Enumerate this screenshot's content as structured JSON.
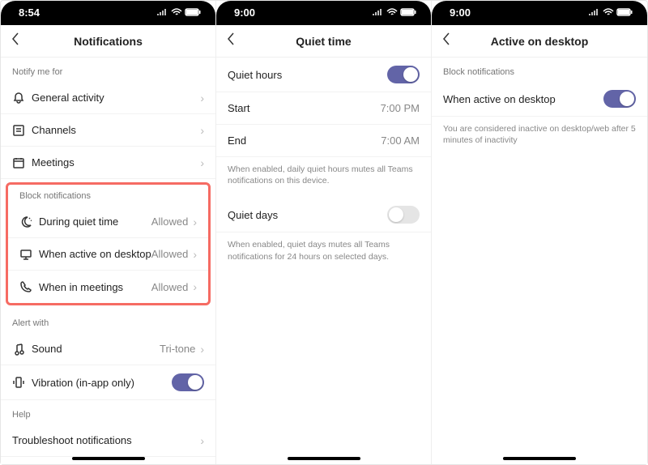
{
  "screens": [
    {
      "time": "8:54",
      "title": "Notifications",
      "sections": {
        "notify": {
          "label": "Notify me for",
          "items": [
            {
              "label": "General activity"
            },
            {
              "label": "Channels"
            },
            {
              "label": "Meetings"
            }
          ]
        },
        "block": {
          "label": "Block notifications",
          "items": [
            {
              "label": "During quiet time",
              "value": "Allowed"
            },
            {
              "label": "When active on desktop",
              "value": "Allowed"
            },
            {
              "label": "When in meetings",
              "value": "Allowed"
            }
          ]
        },
        "alert": {
          "label": "Alert with",
          "sound": {
            "label": "Sound",
            "value": "Tri-tone"
          },
          "vibration": {
            "label": "Vibration (in-app only)",
            "on": true
          }
        },
        "help": {
          "label": "Help",
          "item": {
            "label": "Troubleshoot notifications"
          }
        }
      }
    },
    {
      "time": "9:00",
      "title": "Quiet time",
      "quietHours": {
        "label": "Quiet hours",
        "on": true,
        "start": {
          "label": "Start",
          "value": "7:00 PM"
        },
        "end": {
          "label": "End",
          "value": "7:00 AM"
        },
        "desc": "When enabled, daily quiet hours mutes all Teams notifications on this device."
      },
      "quietDays": {
        "label": "Quiet days",
        "on": false,
        "desc": "When enabled, quiet days mutes all Teams notifications for 24 hours on selected days."
      }
    },
    {
      "time": "9:00",
      "title": "Active on desktop",
      "section": {
        "label": "Block notifications",
        "item": {
          "label": "When active on desktop",
          "on": true
        },
        "desc": "You are considered inactive on desktop/web after 5 minutes of inactivity"
      }
    }
  ]
}
